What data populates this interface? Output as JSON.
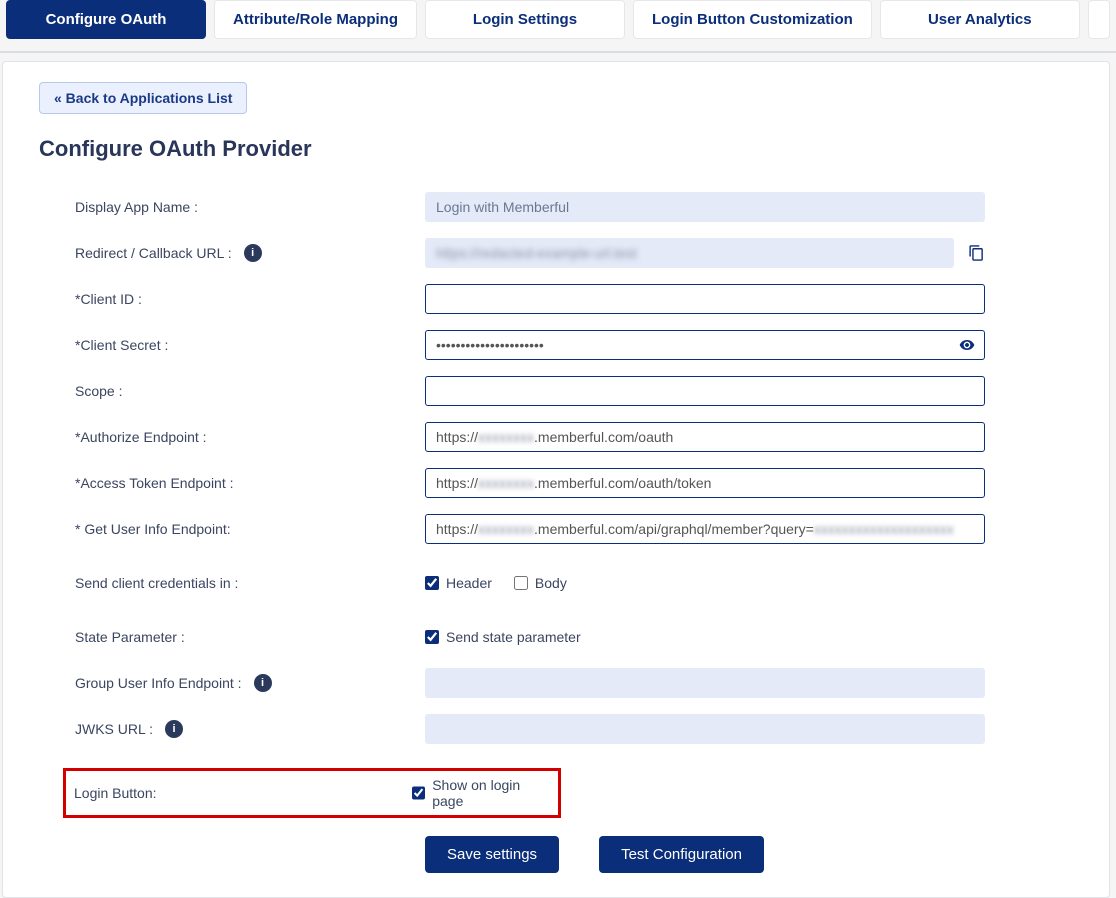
{
  "tabs": {
    "configure_oauth": "Configure OAuth",
    "attribute_role_mapping": "Attribute/Role Mapping",
    "login_settings": "Login Settings",
    "login_button_customization": "Login Button Customization",
    "user_analytics": "User Analytics"
  },
  "back_button": "« Back to Applications List",
  "page_title": "Configure OAuth Provider",
  "labels": {
    "display_app_name": "Display App Name :",
    "redirect_url": "Redirect / Callback URL :",
    "client_id": "*Client ID :",
    "client_secret": "*Client Secret :",
    "scope": "Scope :",
    "authorize_endpoint": "*Authorize Endpoint :",
    "access_token_endpoint": "*Access Token Endpoint :",
    "get_user_info_endpoint": "* Get User Info Endpoint:",
    "send_client_credentials": "Send client credentials in :",
    "state_parameter": "State Parameter :",
    "group_user_info_endpoint": "Group User Info Endpoint :",
    "jwks_url": "JWKS URL :",
    "login_button": "Login Button:"
  },
  "values": {
    "display_app_name": "Login with Memberful",
    "redirect_url": "",
    "client_id": "",
    "client_secret": "••••••••••••••••••••••",
    "scope": "",
    "authorize_prefix": "https://",
    "authorize_suffix": ".memberful.com/oauth",
    "access_token_prefix": "https://",
    "access_token_suffix": ".memberful.com/oauth/token",
    "userinfo_prefix": "https://",
    "userinfo_suffix": ".memberful.com/api/graphql/member?query=",
    "group_user_info": "",
    "jwks_url": ""
  },
  "checkboxes": {
    "header": "Header",
    "body": "Body",
    "send_state": "Send state parameter",
    "show_on_login": "Show on login page"
  },
  "buttons": {
    "save": "Save settings",
    "test": "Test Configuration"
  }
}
